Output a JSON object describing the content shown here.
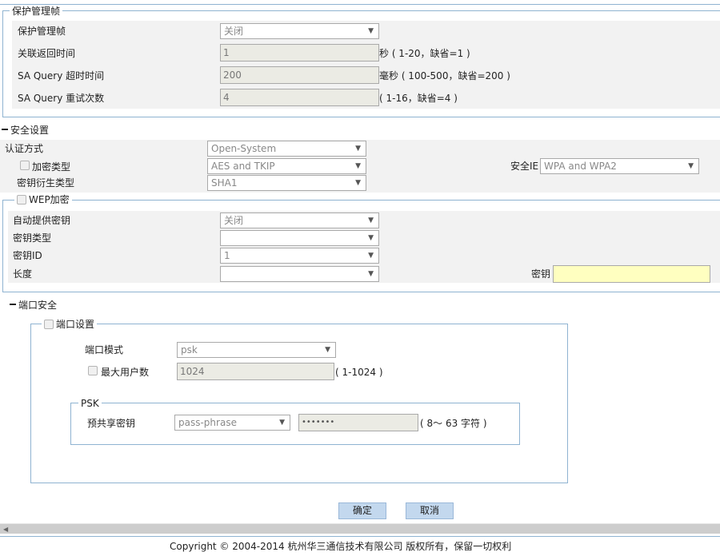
{
  "pmf": {
    "legend": "保护管理帧",
    "rows": [
      {
        "label": "保护管理帧",
        "value": "关闭"
      },
      {
        "label": "关联返回时间",
        "value": "1",
        "hint": "秒 ( 1-20，缺省=1 )"
      },
      {
        "label": "SA Query 超时时间",
        "value": "200",
        "hint": "毫秒 ( 100-500，缺省=200 )"
      },
      {
        "label": "SA Query 重试次数",
        "value": "4",
        "hint": "( 1-16，缺省=4 )"
      }
    ]
  },
  "security": {
    "title": "安全设置",
    "auth_label": "认证方式",
    "auth_value": "Open-System",
    "cipher_label": "加密类型",
    "cipher_value": "AES and TKIP",
    "ie_label": "安全IE",
    "ie_value": "WPA and WPA2",
    "kdf_label": "密钥衍生类型",
    "kdf_value": "SHA1"
  },
  "wep": {
    "legend": "WEP加密",
    "auto_key_label": "自动提供密钥",
    "auto_key_value": "关闭",
    "key_type_label": "密钥类型",
    "key_type_value": "",
    "key_id_label": "密钥ID",
    "key_id_value": "1",
    "length_label": "长度",
    "length_value": "",
    "key_label": "密钥",
    "key_value": ""
  },
  "port_security": {
    "title": "端口安全",
    "legend": "端口设置",
    "mode_label": "端口模式",
    "mode_value": "psk",
    "max_users_label": "最大用户数",
    "max_users_value": "1024",
    "max_users_hint": "( 1-1024 )",
    "psk": {
      "legend": "PSK",
      "label": "预共享密钥",
      "format_value": "pass-phrase",
      "key_value": "•••••••",
      "hint": "( 8～ 63 字符 )"
    }
  },
  "buttons": {
    "ok": "确定",
    "cancel": "取消"
  },
  "footer": {
    "copyright": "Copyright © 2004-2014 杭州华三通信技术有限公司 版权所有，保留一切权利"
  },
  "icons": {
    "dropdown": "chevron-down-icon",
    "scroll_left": "scroll-left-icon"
  }
}
